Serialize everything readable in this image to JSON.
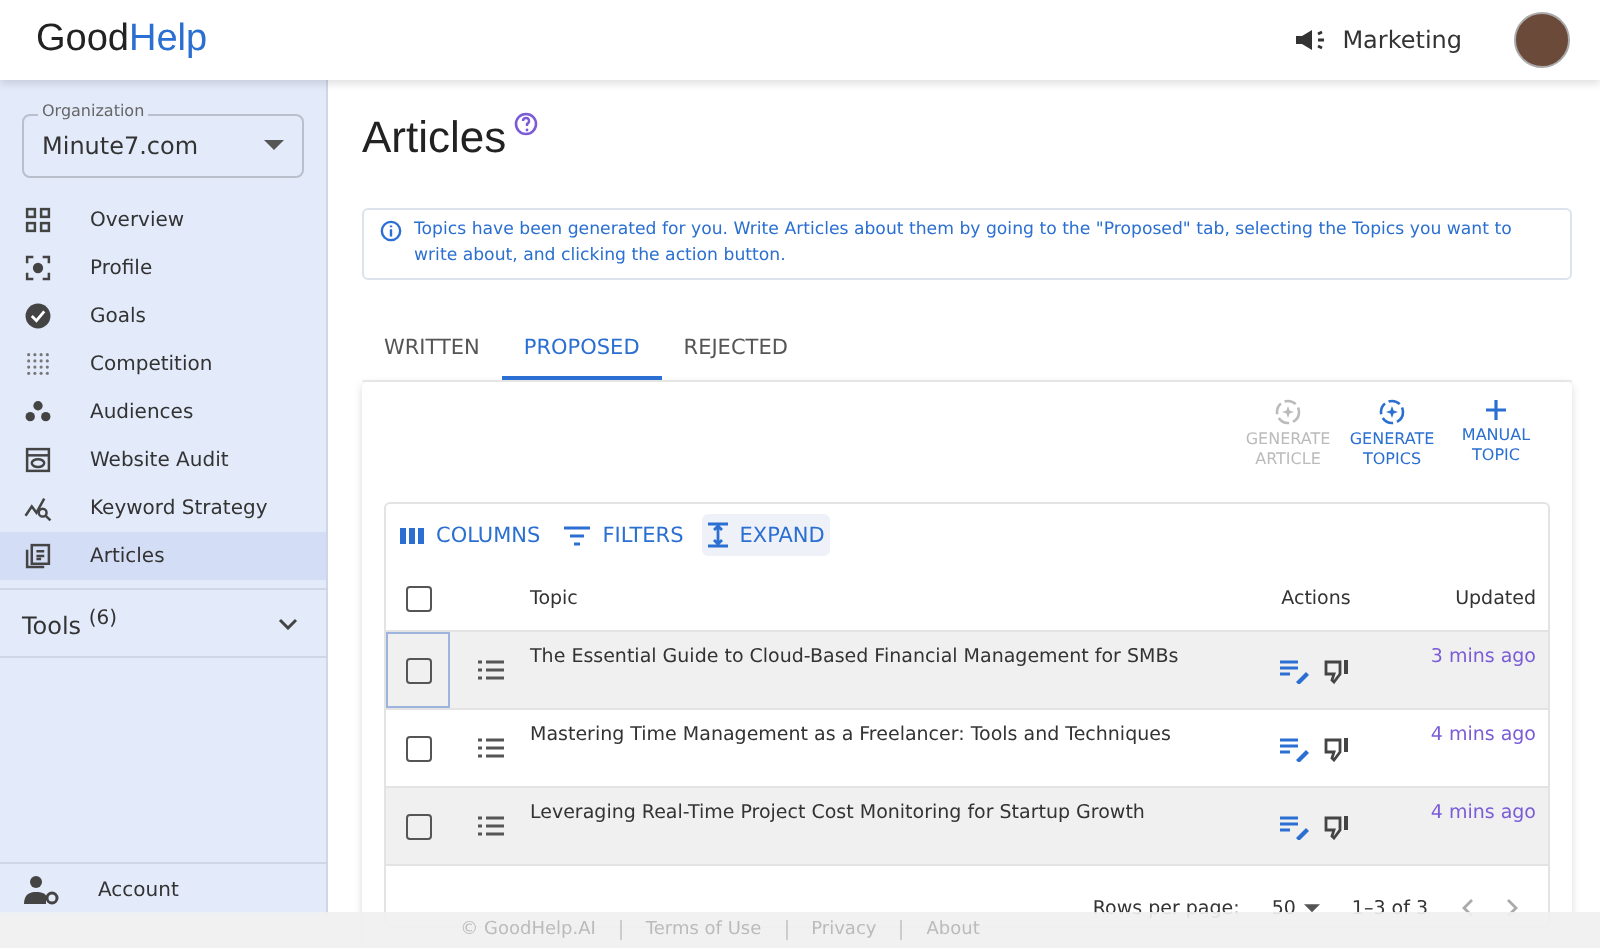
{
  "header": {
    "logo_first": "Good",
    "logo_second": "Help",
    "workspace": "Marketing"
  },
  "sidebar": {
    "org_label": "Organization",
    "org_value": "Minute7.com",
    "items": [
      {
        "label": "Overview",
        "selected": false
      },
      {
        "label": "Profile",
        "selected": false
      },
      {
        "label": "Goals",
        "selected": false
      },
      {
        "label": "Competition",
        "selected": false
      },
      {
        "label": "Audiences",
        "selected": false
      },
      {
        "label": "Website Audit",
        "selected": false
      },
      {
        "label": "Keyword Strategy",
        "selected": false
      },
      {
        "label": "Articles",
        "selected": true
      }
    ],
    "tools": "Tools $^{(6)}$",
    "tools_expanded": false,
    "account": "Account"
  },
  "page": {
    "title": "Articles",
    "info": "Topics have been generated for you. Write Articles about them by going to the \"Proposed\" tab, selecting the Topics you want to write about, and clicking the action button.",
    "tabs": [
      {
        "label": "WRITTEN",
        "selected": false
      },
      {
        "label": "PROPOSED",
        "selected": true
      },
      {
        "label": "REJECTED",
        "selected": false
      }
    ],
    "actions": [
      {
        "label": "GENERATE ARTICLE",
        "disabled": true
      },
      {
        "label": "GENERATE TOPICS",
        "disabled": false
      },
      {
        "label": "MANUAL TOPIC",
        "disabled": false
      }
    ],
    "toolbar": [
      {
        "label": "COLUMNS",
        "selected": false
      },
      {
        "label": "FILTERS",
        "selected": false
      },
      {
        "label": "EXPAND",
        "selected": true
      }
    ],
    "table": {
      "columns": [
        "Topic",
        "Actions",
        "Updated"
      ],
      "select_all_checked": false,
      "rows": [
        {
          "topic": "The Essential Guide to Cloud-Based Financial Management for SMBs",
          "updated": "3 mins ago",
          "highlighted": true,
          "checked": false
        },
        {
          "topic": "Mastering Time Management as a Freelancer: Tools and Techniques",
          "updated": "4 mins ago",
          "highlighted": false,
          "checked": false
        },
        {
          "topic": "Leveraging Real-Time Project Cost Monitoring for Startup Growth",
          "updated": "4 mins ago",
          "highlighted": true,
          "checked": false
        }
      ],
      "rows_per_page_label": "Rows per page:",
      "rows_per_page": "50",
      "range": "1–3 of 3"
    }
  },
  "footer": [
    "© GoodHelp.AI",
    "Terms of Use",
    "Privacy",
    "About"
  ]
}
